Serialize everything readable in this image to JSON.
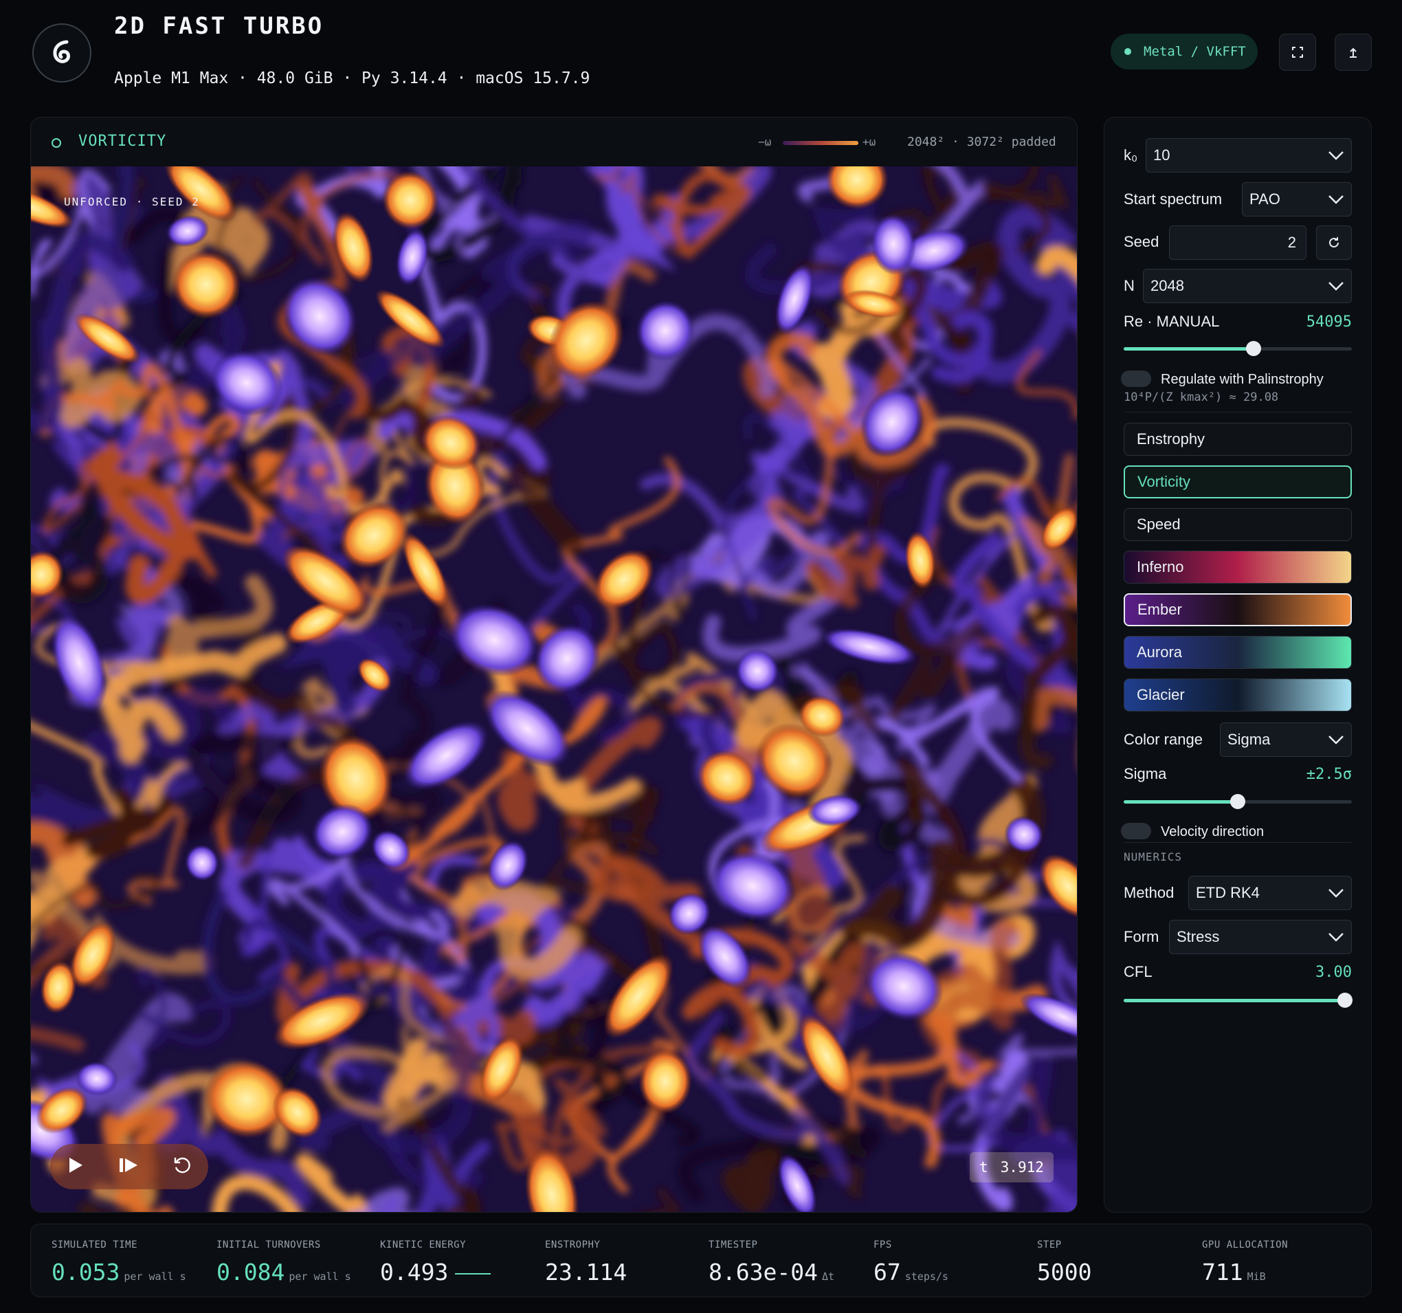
{
  "header": {
    "title": "2D FAST TURBO",
    "subtitle": "Apple M1 Max · 48.0 GiB · Py 3.14.4 · macOS 15.7.9",
    "backend": "Metal / VkFFT"
  },
  "viewer": {
    "label": "VORTICITY",
    "legend_neg": "−ω",
    "legend_pos": "+ω",
    "resolution": "2048² · 3072² padded",
    "overlay_tag": "UNFORCED · SEED 2",
    "time_label": "t",
    "time_value": "3.912"
  },
  "sidebar": {
    "k0_label": "k₀",
    "k0_value": "10",
    "start_spectrum_label": "Start spectrum",
    "start_spectrum_value": "PAO",
    "seed_label": "Seed",
    "seed_value": "2",
    "n_label": "N",
    "n_value": "2048",
    "re_label": "Re · MANUAL",
    "re_value": "54095",
    "re_slider": 0.57,
    "regulate_label": "Regulate with Palinstrophy",
    "regulate_formula": "10⁴P/(Z kmax²) ≈ 29.08",
    "fields": [
      "Enstrophy",
      "Vorticity",
      "Speed"
    ],
    "active_field": "Vorticity",
    "colormaps": [
      {
        "name": "Inferno",
        "gradient": [
          "#1a0b2e",
          "#b01f4a",
          "#f4d58a"
        ]
      },
      {
        "name": "Ember",
        "gradient": [
          "#5b1e8a",
          "#1a0f14",
          "#f08c3c"
        ]
      },
      {
        "name": "Aurora",
        "gradient": [
          "#2b3a9a",
          "#1a2540",
          "#5ee8b0"
        ]
      },
      {
        "name": "Glacier",
        "gradient": [
          "#1f3f8e",
          "#0f1a2c",
          "#a7e2f2"
        ]
      }
    ],
    "active_colormap": "Ember",
    "color_range_label": "Color range",
    "color_range_value": "Sigma",
    "sigma_label": "Sigma",
    "sigma_value": "±2.5σ",
    "sigma_slider": 0.5,
    "velocity_label": "Velocity direction",
    "numerics_header": "NUMERICS",
    "method_label": "Method",
    "method_value": "ETD RK4",
    "form_label": "Form",
    "form_value": "Stress",
    "cfl_label": "CFL",
    "cfl_value": "3.00",
    "cfl_slider": 0.97
  },
  "stats": [
    {
      "label": "SIMULATED TIME",
      "value": "0.053",
      "unit": "per wall s",
      "accent": true
    },
    {
      "label": "INITIAL TURNOVERS",
      "value": "0.084",
      "unit": "per wall s",
      "accent": true
    },
    {
      "label": "KINETIC ENERGY",
      "value": "0.493",
      "unit": "",
      "accent": false
    },
    {
      "label": "ENSTROPHY",
      "value": "23.114",
      "unit": "",
      "accent": false
    },
    {
      "label": "TIMESTEP",
      "value": "8.63e-04",
      "unit": "Δt",
      "accent": false
    },
    {
      "label": "FPS",
      "value": "67",
      "unit": "steps/s",
      "accent": false
    },
    {
      "label": "STEP",
      "value": "5000",
      "unit": "",
      "accent": false
    },
    {
      "label": "GPU ALLOCATION",
      "value": "711",
      "unit": "MiB",
      "accent": false
    }
  ],
  "icons": {
    "logo": "spiral-icon",
    "backend_status": "status-dot-icon",
    "fullscreen": "fullscreen-icon",
    "export": "export-icon",
    "play": "play-icon",
    "step": "step-forward-icon",
    "reset": "reset-icon",
    "reseed": "refresh-icon"
  }
}
